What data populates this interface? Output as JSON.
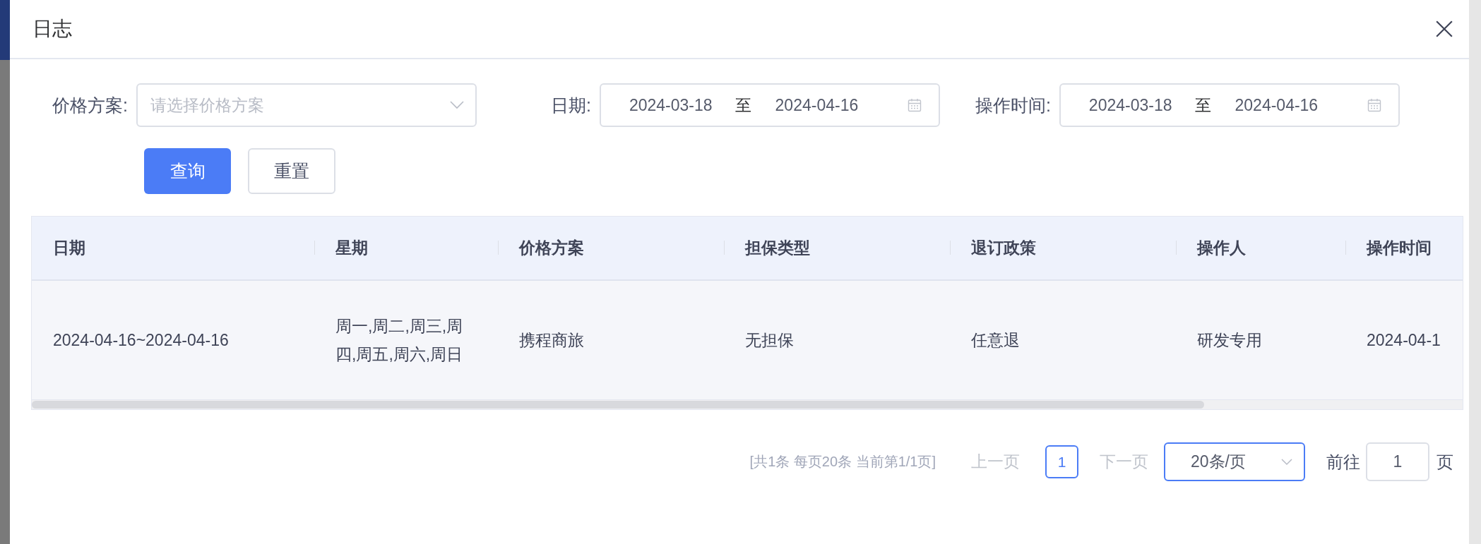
{
  "dialog": {
    "title": "日志"
  },
  "filters": [
    {
      "kind": "select",
      "label": "价格方案:",
      "placeholder": "请选择价格方案"
    },
    {
      "kind": "daterange",
      "label": "日期:",
      "start": "2024-03-18",
      "separator": "至",
      "end": "2024-04-16"
    },
    {
      "kind": "daterange",
      "label": "操作时间:",
      "start": "2024-03-18",
      "separator": "至",
      "end": "2024-04-16"
    }
  ],
  "buttons": [
    {
      "label": "查询",
      "kind": "primary"
    },
    {
      "label": "重置",
      "kind": "default"
    }
  ],
  "table": {
    "columns": [
      "日期",
      "星期",
      "价格方案",
      "担保类型",
      "退订政策",
      "操作人",
      "操作时间"
    ],
    "rows": [
      [
        "2024-04-16~2024-04-16",
        "周一,周二,周三,周四,周五,周六,周日",
        "携程商旅",
        "无担保",
        "任意退",
        "研发专用",
        "2024-04-1"
      ]
    ]
  },
  "pagination": {
    "summary": "[共1条 每页20条 当前第1/1页]",
    "prev": {
      "label": "上一页",
      "disabled": true
    },
    "pages": [
      {
        "label": "1",
        "selected": true
      }
    ],
    "next": {
      "label": "下一页",
      "disabled": true
    },
    "page_size": "20条/页",
    "goto_label": "前往",
    "goto_value": "1",
    "goto_suffix": "页"
  }
}
